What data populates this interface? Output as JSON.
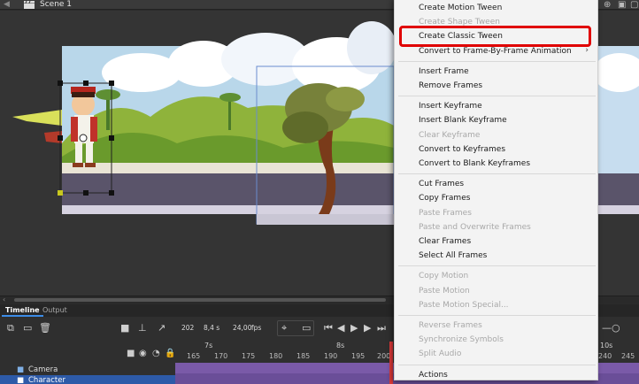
{
  "topbar": {
    "scene_label": "Scene 1",
    "back_icon": "arrow-left-icon",
    "clapper_icon": "clapperboard-icon",
    "right_icons": [
      "crosshair-icon",
      "fit-icon",
      "frame-icon"
    ]
  },
  "timeline": {
    "tabs": [
      {
        "label": "Timeline",
        "active": true
      },
      {
        "label": "Output",
        "active": false
      }
    ],
    "current_frame": "202",
    "time": "8,4 s",
    "fps_value": "24,00",
    "fps_unit": "fps",
    "second_markers": [
      "7s",
      "8s",
      "10s"
    ],
    "frame_numbers": [
      "165",
      "170",
      "175",
      "180",
      "185",
      "190",
      "195",
      "200",
      "240",
      "245"
    ],
    "layers": [
      {
        "name": "Camera",
        "selected": false
      },
      {
        "name": "Character",
        "selected": true
      }
    ]
  },
  "context_menu": {
    "items": [
      {
        "label": "Create Motion Tween",
        "enabled": true
      },
      {
        "label": "Create Shape Tween",
        "enabled": false
      },
      {
        "label": "Create Classic Tween",
        "enabled": true,
        "highlighted": true
      },
      {
        "label": "Convert to Frame-By-Frame Animation",
        "enabled": true,
        "submenu": true
      },
      {
        "separator": true
      },
      {
        "label": "Insert Frame",
        "enabled": true
      },
      {
        "label": "Remove Frames",
        "enabled": true
      },
      {
        "separator": true
      },
      {
        "label": "Insert Keyframe",
        "enabled": true
      },
      {
        "label": "Insert Blank Keyframe",
        "enabled": true
      },
      {
        "label": "Clear Keyframe",
        "enabled": false
      },
      {
        "label": "Convert to Keyframes",
        "enabled": true
      },
      {
        "label": "Convert to Blank Keyframes",
        "enabled": true
      },
      {
        "separator": true
      },
      {
        "label": "Cut Frames",
        "enabled": true
      },
      {
        "label": "Copy Frames",
        "enabled": true
      },
      {
        "label": "Paste Frames",
        "enabled": false
      },
      {
        "label": "Paste and Overwrite Frames",
        "enabled": false
      },
      {
        "label": "Clear Frames",
        "enabled": true
      },
      {
        "label": "Select All Frames",
        "enabled": true
      },
      {
        "separator": true
      },
      {
        "label": "Copy Motion",
        "enabled": false
      },
      {
        "label": "Paste Motion",
        "enabled": false
      },
      {
        "label": "Paste Motion Special...",
        "enabled": false
      },
      {
        "separator": true
      },
      {
        "label": "Reverse Frames",
        "enabled": false
      },
      {
        "label": "Synchronize Symbols",
        "enabled": false
      },
      {
        "label": "Split Audio",
        "enabled": false
      },
      {
        "separator": true
      },
      {
        "label": "Actions",
        "enabled": true
      }
    ]
  },
  "colors": {
    "highlight_border": "#e00000",
    "playhead": "#e03a3a",
    "selected_layer": "#2d5aa8",
    "frame_purple": "#7a5aa8"
  }
}
